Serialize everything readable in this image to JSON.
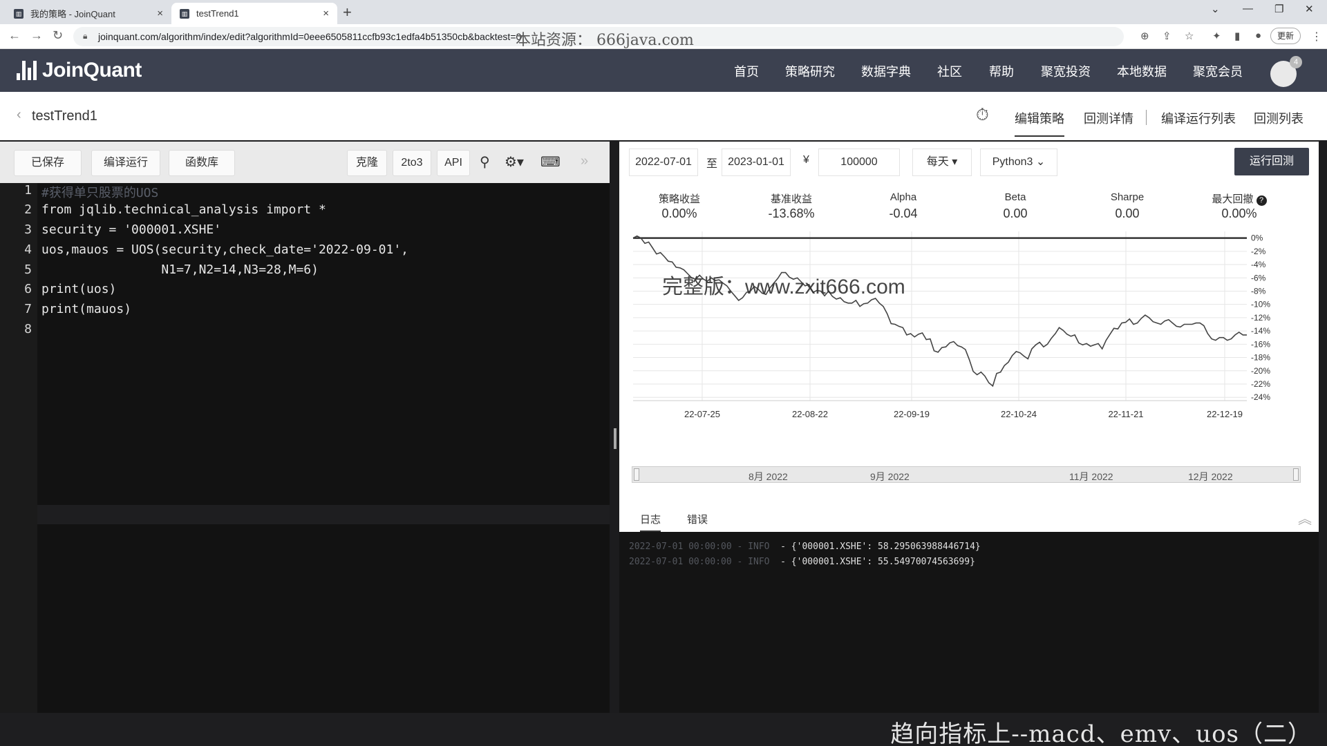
{
  "browser": {
    "tabs": [
      {
        "title": "我的策略 - JoinQuant",
        "active": false
      },
      {
        "title": "testTrend1",
        "active": true
      }
    ],
    "url": "joinquant.com/algorithm/index/edit?algorithmId=0eee6505811ccfb93c1edfa4b51350cb&backtest=0",
    "watermark_url": "本站资源：  666java.com",
    "update_label": "更新",
    "tab_icon": "joinquant-favicon"
  },
  "app": {
    "logo_text": "JoinQuant",
    "nav": [
      "首页",
      "策略研究",
      "数据字典",
      "社区",
      "帮助",
      "聚宽投资",
      "本地数据",
      "聚宽会员"
    ],
    "notification_count": "4"
  },
  "strategy": {
    "name": "testTrend1",
    "tabs": [
      "编辑策略",
      "回测详情",
      "编译运行列表",
      "回测列表"
    ],
    "active_tab": "编辑策略"
  },
  "toolbar": {
    "saved": "已保存",
    "compile_run": "编译运行",
    "func_lib": "函数库",
    "clone": "克隆",
    "to3": "2to3",
    "api": "API",
    "icons": [
      "search-icon",
      "gear-icon",
      "keyboard-icon",
      "double-chevron-right-icon"
    ]
  },
  "editor": {
    "line_numbers": [
      "1",
      "2",
      "3",
      "4",
      "5",
      "6",
      "7",
      "8"
    ],
    "code": [
      "#获得单只股票的UOS",
      "from jqlib.technical_analysis import *",
      "security = '000001.XSHE'",
      "uos,mauos = UOS(security,check_date='2022-09-01',",
      "                N1=7,N2=14,N3=28,M=6)",
      "print(uos)",
      "print(mauos)",
      ""
    ],
    "current_line": 8
  },
  "backtest": {
    "start_date": "2022-07-01",
    "to_label": "至",
    "end_date": "2023-01-01",
    "currency_symbol": "¥",
    "capital": "100000",
    "frequency": "每天",
    "python_version": "Python3",
    "run_label": "运行回测"
  },
  "metrics": [
    {
      "label": "策略收益",
      "value": "0.00%"
    },
    {
      "label": "基准收益",
      "value": "-13.68%"
    },
    {
      "label": "Alpha",
      "value": "-0.04"
    },
    {
      "label": "Beta",
      "value": "0.00"
    },
    {
      "label": "Sharpe",
      "value": "0.00"
    },
    {
      "label": "最大回撤",
      "value": "0.00%"
    }
  ],
  "chart_watermark": "完整版：www.zxit666.com",
  "chart_data": {
    "type": "line",
    "x_ticks": [
      "22-07-25",
      "22-08-22",
      "22-09-19",
      "22-10-24",
      "22-11-21",
      "22-12-19"
    ],
    "y_ticks": [
      "0%",
      "-2%",
      "-4%",
      "-6%",
      "-8%",
      "-10%",
      "-12%",
      "-14%",
      "-16%",
      "-18%",
      "-20%",
      "-22%",
      "-24%"
    ],
    "ylim": [
      -24.5,
      1
    ],
    "grid": true,
    "colors": {
      "strategy": "#333333",
      "benchmark": "#444444",
      "grid": "#e6e6e6"
    },
    "series": [
      {
        "values": [
          0,
          0,
          0,
          0,
          0,
          0,
          0,
          0,
          0,
          0,
          0,
          0,
          0,
          0,
          0,
          0,
          0,
          0,
          0,
          0,
          0,
          0,
          0,
          0,
          0,
          0,
          0,
          0,
          0,
          0,
          0,
          0,
          0,
          0,
          0,
          0,
          0,
          0,
          0,
          0,
          0,
          0,
          0,
          0,
          0,
          0,
          0,
          0,
          0,
          0,
          0,
          0,
          0,
          0,
          0,
          0,
          0,
          0,
          0,
          0,
          0,
          0,
          0,
          0,
          0,
          0,
          0,
          0,
          0,
          0,
          0,
          0,
          0,
          0,
          0,
          0,
          0,
          0,
          0,
          0,
          0,
          0,
          0,
          0,
          0,
          0,
          0,
          0,
          0,
          0,
          0,
          0,
          0,
          0,
          0,
          0,
          0,
          0,
          0,
          0,
          0,
          0,
          0,
          0,
          0,
          0,
          0,
          0,
          0,
          0,
          0,
          0,
          0,
          0,
          0,
          0,
          0,
          0,
          0,
          0,
          0,
          0
        ]
      },
      {
        "values": [
          0.0,
          0.3,
          0.0,
          -0.8,
          -0.6,
          -1.5,
          -2.4,
          -2.2,
          -2.8,
          -3.5,
          -3.6,
          -4.4,
          -4.5,
          -4.8,
          -5.4,
          -6.0,
          -6.2,
          -5.6,
          -6.2,
          -6.5,
          -6.0,
          -6.4,
          -6.3,
          -6.8,
          -7.2,
          -8.0,
          -8.7,
          -9.4,
          -9.0,
          -8.2,
          -8.0,
          -7.3,
          -7.7,
          -8.3,
          -8.5,
          -7.5,
          -6.8,
          -6.1,
          -5.2,
          -5.2,
          -5.9,
          -6.2,
          -6.0,
          -6.6,
          -7.2,
          -7.0,
          -8.2,
          -7.9,
          -8.0,
          -8.7,
          -8.0,
          -8.8,
          -9.2,
          -9.0,
          -9.6,
          -9.8,
          -9.8,
          -9.4,
          -10.3,
          -9.9,
          -9.8,
          -9.3,
          -9.1,
          -9.8,
          -10.3,
          -11.4,
          -12.9,
          -13.0,
          -13.3,
          -13.5,
          -14.6,
          -14.4,
          -14.9,
          -14.5,
          -14.3,
          -15.3,
          -15.2,
          -17.0,
          -17.2,
          -16.5,
          -16.4,
          -15.8,
          -15.6,
          -16.2,
          -16.4,
          -16.8,
          -18.3,
          -20.1,
          -20.6,
          -20.2,
          -20.8,
          -21.8,
          -22.3,
          -20.4,
          -20.2,
          -19.2,
          -18.7,
          -17.7,
          -17.1,
          -17.3,
          -17.8,
          -18.2,
          -16.7,
          -16.1,
          -15.7,
          -16.4,
          -16.0,
          -15.1,
          -14.4,
          -13.5,
          -13.9,
          -14.5,
          -14.8,
          -14.6,
          -15.8,
          -16.1,
          -15.9,
          -16.3,
          -16.1,
          -15.9,
          -16.7,
          -15.4,
          -14.5,
          -13.6,
          -13.7,
          -12.8,
          -12.7,
          -12.2,
          -13.0,
          -12.8,
          -12.1,
          -11.6,
          -12.0,
          -12.6,
          -12.8,
          -13.0,
          -12.5,
          -12.3,
          -12.8,
          -13.3,
          -13.4,
          -13.0,
          -13.0,
          -13.0,
          -12.8,
          -12.8,
          -13.2,
          -14.4,
          -15.2,
          -15.4,
          -15.0,
          -15.0,
          -15.4,
          -15.2,
          -14.6,
          -14.2,
          -14.6,
          -14.6
        ]
      }
    ]
  },
  "navigator": {
    "months": [
      "8月 2022",
      "9月 2022",
      "11月 2022",
      "12月 2022"
    ]
  },
  "logs": {
    "tabs": [
      "日志",
      "错误"
    ],
    "lines": [
      {
        "time": "2022-07-01 00:00:00 - INFO",
        "msg": "- {'000001.XSHE': 58.295063988446714}"
      },
      {
        "time": "2022-07-01 00:00:00 - INFO",
        "msg": "- {'000001.XSHE': 55.54970074563699}"
      }
    ]
  },
  "video_subtitle": "趋向指标上--macd、emv、uos（二）"
}
